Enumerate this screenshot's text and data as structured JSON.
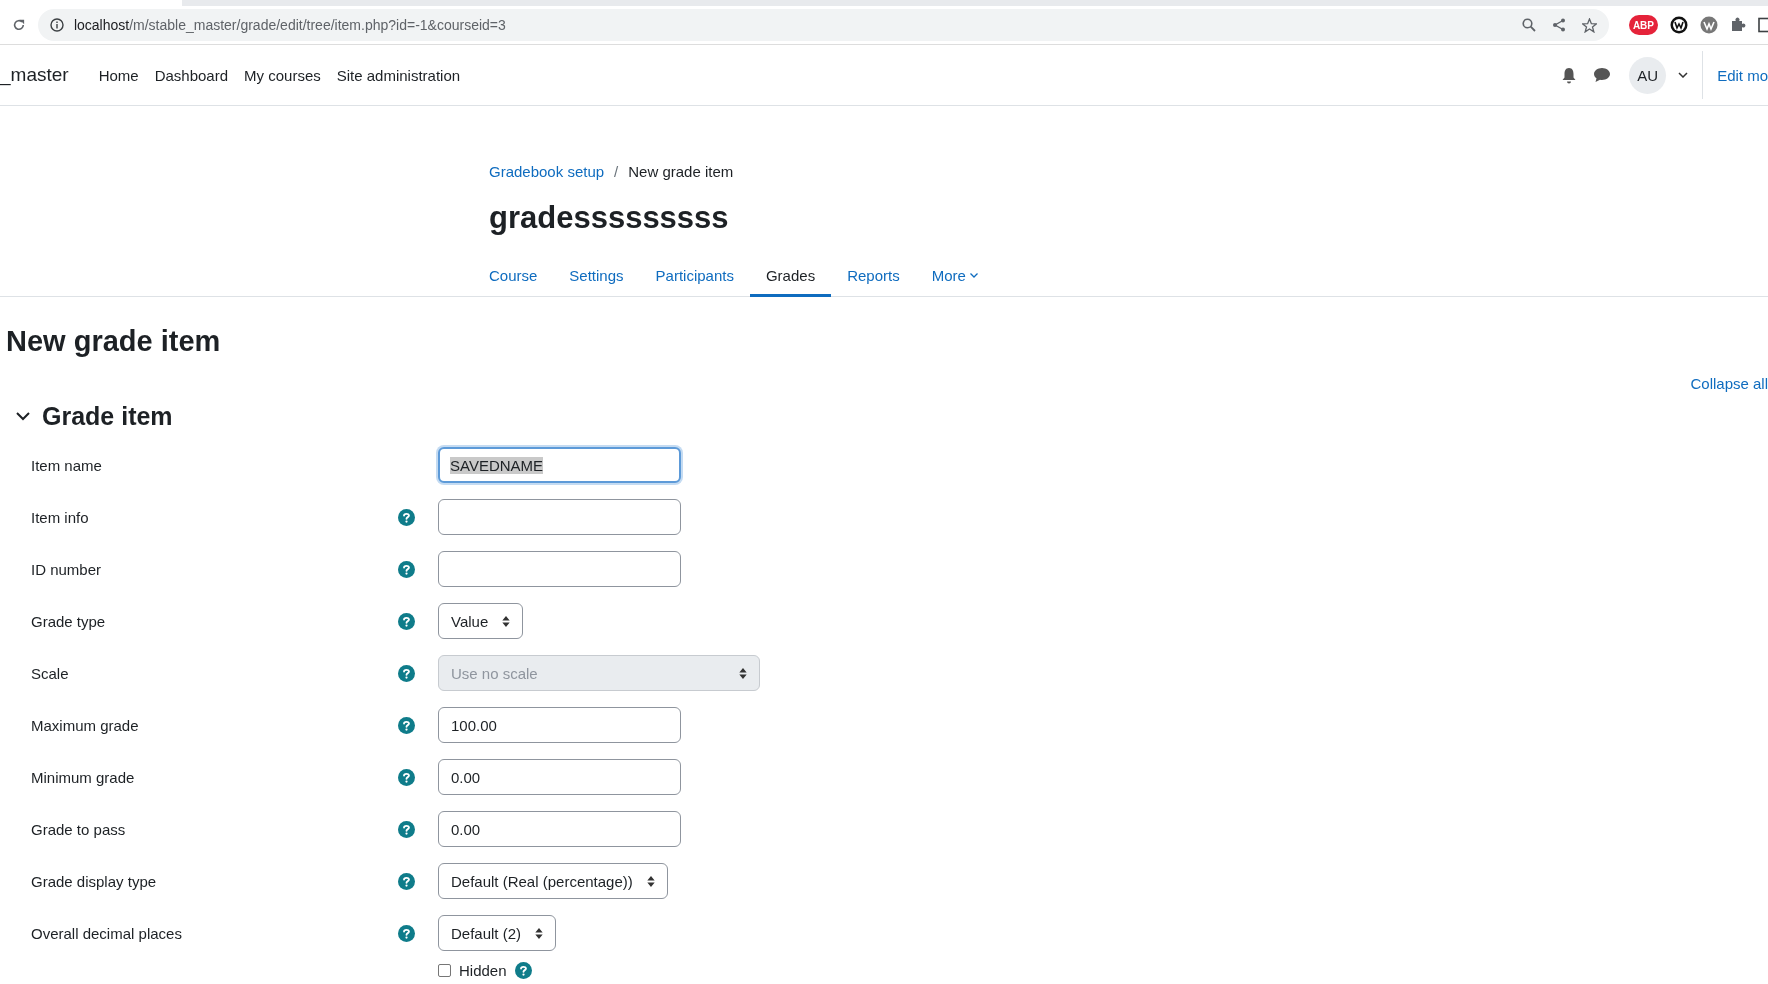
{
  "browser": {
    "url_host": "localhost",
    "url_path": "/m/stable_master/grade/edit/tree/item.php?id=-1&courseid=3",
    "extension_badge": "ABP"
  },
  "navbar": {
    "site_name": "_master",
    "links": [
      "Home",
      "Dashboard",
      "My courses",
      "Site administration"
    ],
    "avatar": "AU",
    "edit_mode": "Edit mo"
  },
  "breadcrumb": [
    {
      "label": "Gradebook setup",
      "link": true
    },
    {
      "label": "New grade item",
      "link": false
    }
  ],
  "breadcrumb_separator": "/",
  "course_title": "gradesssssssss",
  "tabs": [
    {
      "label": "Course",
      "selected": false,
      "kind": "link"
    },
    {
      "label": "Settings",
      "selected": false,
      "kind": "link"
    },
    {
      "label": "Participants",
      "selected": false,
      "kind": "link"
    },
    {
      "label": "Grades",
      "selected": true,
      "kind": "link"
    },
    {
      "label": "Reports",
      "selected": false,
      "kind": "link"
    },
    {
      "label": "More",
      "selected": false,
      "kind": "dropdown"
    }
  ],
  "page_heading": "New grade item",
  "collapse_all": "Collapse all",
  "section": {
    "title": "Grade item",
    "expanded": true
  },
  "fields": [
    {
      "label": "Item name",
      "kind": "text",
      "value": "SAVEDNAME",
      "help": false,
      "focused": true
    },
    {
      "label": "Item info",
      "kind": "text",
      "help": true,
      "focused": false
    },
    {
      "label": "ID number",
      "kind": "text",
      "help": true,
      "focused": false
    },
    {
      "label": "Grade type",
      "kind": "select",
      "value": "Value",
      "help": true,
      "disabled": false
    },
    {
      "label": "Scale",
      "kind": "select",
      "value": "Use no scale",
      "help": true,
      "disabled": true
    },
    {
      "label": "Maximum grade",
      "kind": "text",
      "value": "100.00",
      "help": true,
      "focused": false
    },
    {
      "label": "Minimum grade",
      "kind": "text",
      "value": "0.00",
      "help": true,
      "focused": false
    },
    {
      "label": "Grade to pass",
      "kind": "text",
      "value": "0.00",
      "help": true,
      "focused": false
    },
    {
      "label": "Grade display type",
      "kind": "select",
      "value": "Default (Real (percentage))",
      "help": true,
      "disabled": false
    },
    {
      "label": "Overall decimal places",
      "kind": "select",
      "value": "Default (2)",
      "help": true,
      "disabled": false
    },
    {
      "label": "Hidden",
      "kind": "checkbox",
      "checked": false,
      "help": true
    }
  ]
}
